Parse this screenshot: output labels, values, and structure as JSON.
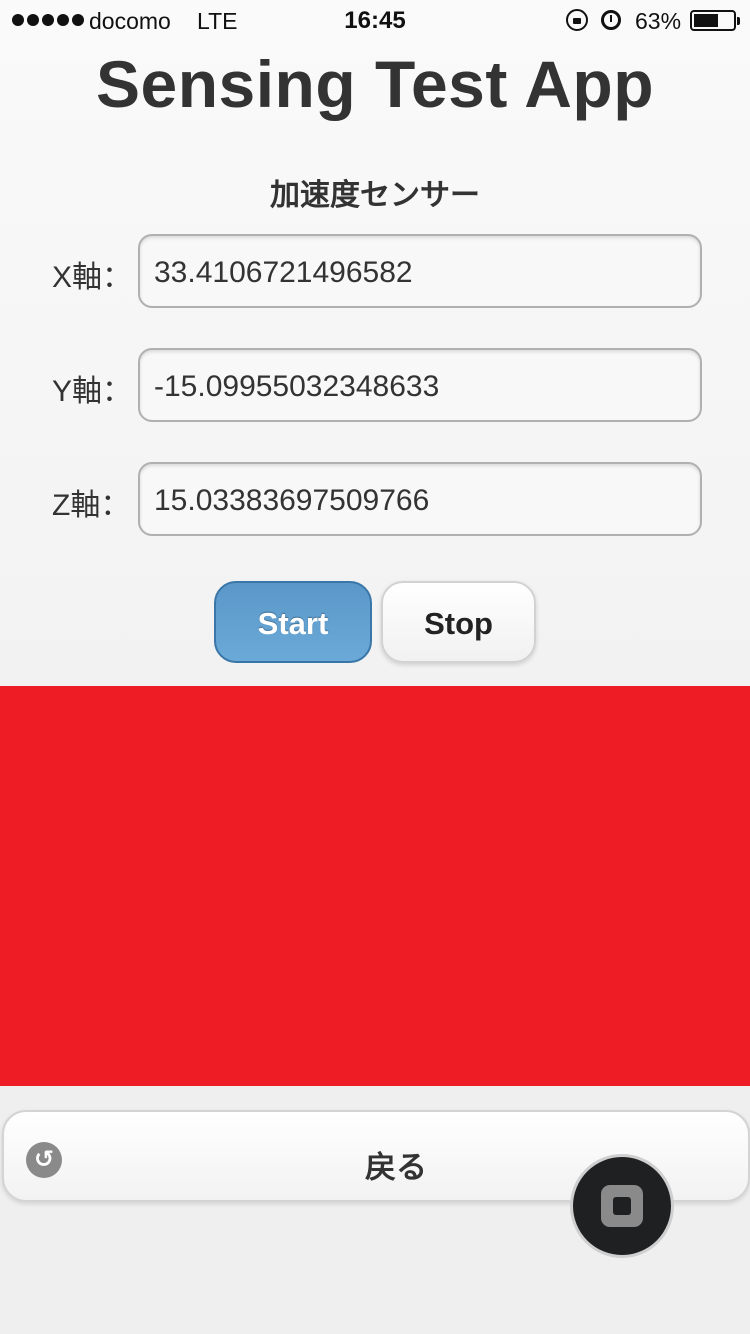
{
  "status_bar": {
    "carrier": "docomo",
    "network": "LTE",
    "time": "16:45",
    "battery_percent_label": "63%",
    "battery_level": 0.63
  },
  "app": {
    "title": "Sensing Test App",
    "section_title": "加速度センサー"
  },
  "sensor": {
    "x_label": "X軸：",
    "x_value": "33.4106721496582",
    "y_label": "Y軸：",
    "y_value": "-15.09955032348633",
    "z_label": "Z軸：",
    "z_value": "15.03383697509766"
  },
  "buttons": {
    "start": "Start",
    "stop": "Stop"
  },
  "indicator": {
    "color": "#ee1c24"
  },
  "footer": {
    "back_label": "戻る",
    "back_icon": "undo-icon",
    "assistive_icon": "assistive-touch-icon"
  }
}
